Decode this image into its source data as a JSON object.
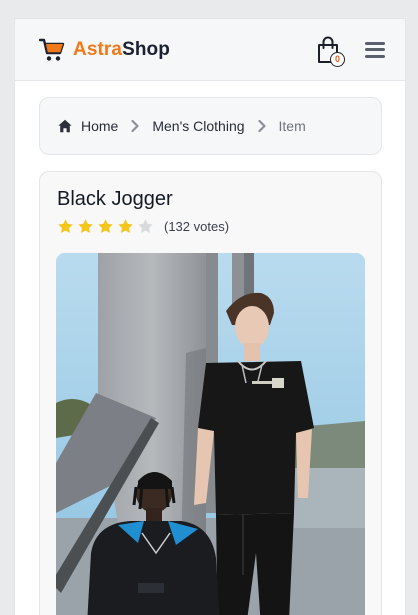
{
  "header": {
    "brand_primary": "Astra",
    "brand_secondary": "Shop",
    "cart_count": "0",
    "accent_color": "#f07a1a"
  },
  "breadcrumb": {
    "home": "Home",
    "category": "Men's Clothing",
    "current": "Item"
  },
  "product": {
    "title": "Black Jogger",
    "rating": 4,
    "rating_max": 5,
    "votes": "(132 votes)",
    "star_color": "#f5c518"
  },
  "icons": [
    "shopping-cart-icon",
    "shopping-bag-icon",
    "hamburger-menu-icon",
    "home-icon",
    "chevron-right-icon",
    "star-icon"
  ]
}
